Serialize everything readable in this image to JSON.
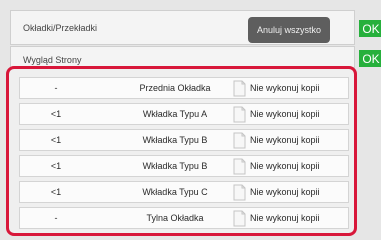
{
  "header": {
    "title": "Okładki/Przekładki",
    "cancel_all_label": "Anuluj wszystko",
    "ok_label": "OK"
  },
  "layout_row": {
    "title": "Wygląd Strony",
    "ok_label": "OK"
  },
  "items": [
    {
      "count": "-",
      "name": "Przednia Okładka",
      "icon": "document-icon",
      "copy": "Nie wykonuj kopii"
    },
    {
      "count": "<1",
      "name": "Wkładka Typu A",
      "icon": "document-icon",
      "copy": "Nie wykonuj kopii"
    },
    {
      "count": "<1",
      "name": "Wkładka Typu B",
      "icon": "document-icon",
      "copy": "Nie wykonuj kopii"
    },
    {
      "count": "<1",
      "name": "Wkładka Typu B",
      "icon": "document-icon",
      "copy": "Nie wykonuj kopii"
    },
    {
      "count": "<1",
      "name": "Wkładka Typu C",
      "icon": "document-icon",
      "copy": "Nie wykonuj kopii"
    },
    {
      "count": "-",
      "name": "Tylna Okładka",
      "icon": "document-icon",
      "copy": "Nie wykonuj kopii"
    }
  ],
  "colors": {
    "ok_green": "#26b03c",
    "highlight_red": "#d8173a",
    "cancel_button": "#5e5e5e"
  }
}
